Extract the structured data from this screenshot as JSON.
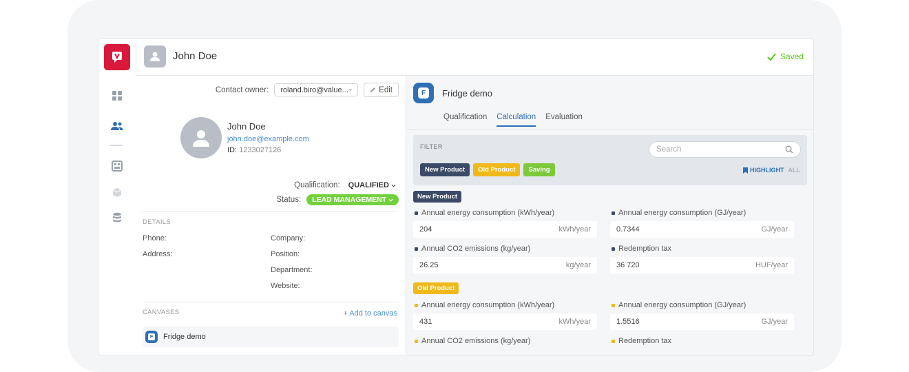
{
  "header": {
    "title": "John Doe",
    "saved_label": "Saved"
  },
  "owner": {
    "label": "Contact owner:",
    "value": "roland.biro@value...",
    "edit_label": "Edit"
  },
  "contact": {
    "name": "John Doe",
    "email": "john.doe@example.com",
    "id_label": "ID:",
    "id_value": "1233027126"
  },
  "qualification": {
    "label": "Qualification:",
    "value": "QUALIFIED"
  },
  "status": {
    "label": "Status:",
    "value": "LEAD MANAGEMENT"
  },
  "details": {
    "heading": "DETAILS",
    "left_fields": [
      "Phone:",
      "Address:"
    ],
    "right_fields": [
      "Company:",
      "Position:",
      "Department:",
      "Website:"
    ]
  },
  "canvases": {
    "heading": "CANVASES",
    "add_label": "+ Add to canvas",
    "items": [
      "Fridge demo"
    ]
  },
  "canvas": {
    "badge_letter": "F",
    "title": "Fridge demo",
    "tabs": [
      "Qualification",
      "Calculation",
      "Evaluation"
    ],
    "active_tab": "Calculation"
  },
  "filter": {
    "label": "FILTER",
    "search_placeholder": "Search",
    "chips": [
      {
        "label": "New Product",
        "color": "#3b4a66"
      },
      {
        "label": "Old Product",
        "color": "#f0b91a"
      },
      {
        "label": "Saving",
        "color": "#7cc93a"
      }
    ],
    "highlight_label": "HIGHLIGHT",
    "all_label": "ALL"
  },
  "sections": [
    {
      "tag": "New Product",
      "color": "#3b4a66",
      "metrics": [
        {
          "label": "Annual energy consumption (kWh/year)",
          "value": "204",
          "unit": "kWh/year"
        },
        {
          "label": "Annual energy consumption (GJ/year)",
          "value": "0.7344",
          "unit": "GJ/year"
        },
        {
          "label": "Annual CO2 emissions (kg/year)",
          "value": "26.25",
          "unit": "kg/year"
        },
        {
          "label": "Redemption tax",
          "value": "36 720",
          "unit": "HUF/year"
        }
      ]
    },
    {
      "tag": "Old Product",
      "color": "#f0b91a",
      "metrics": [
        {
          "label": "Annual energy consumption (kWh/year)",
          "value": "431",
          "unit": "kWh/year"
        },
        {
          "label": "Annual energy consumption (GJ/year)",
          "value": "1.5516",
          "unit": "GJ/year"
        },
        {
          "label": "Annual CO2 emissions (kg/year)",
          "value": "",
          "unit": ""
        },
        {
          "label": "Redemption tax",
          "value": "",
          "unit": ""
        }
      ]
    }
  ],
  "colors": {
    "brand": "#d8193b",
    "accent": "#2f6fb3",
    "success": "#52c41a"
  }
}
